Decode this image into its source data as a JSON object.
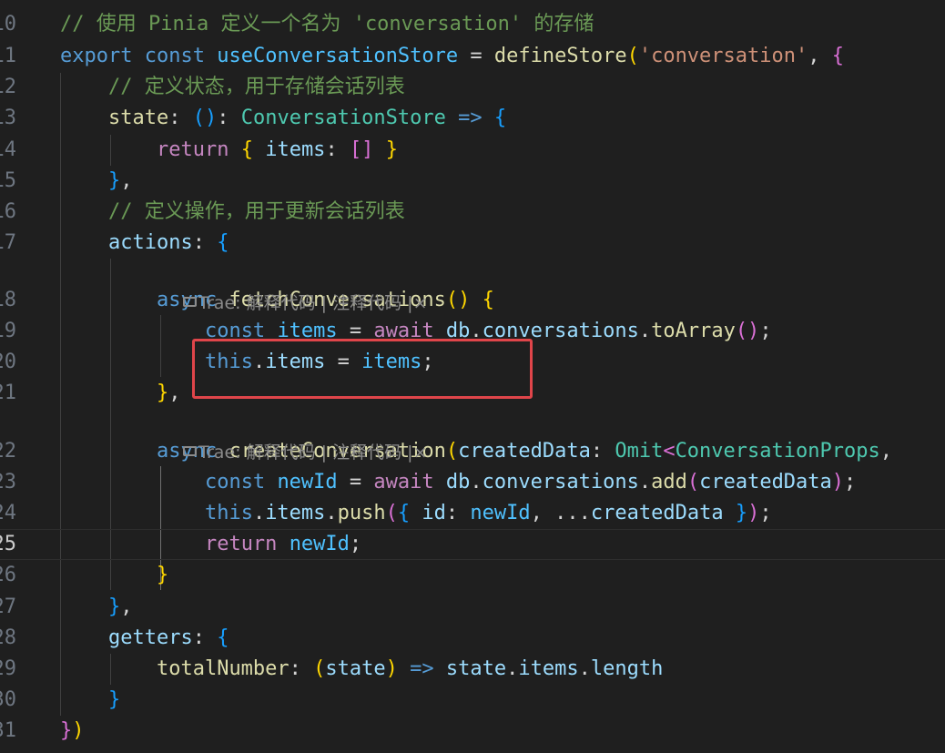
{
  "editor": {
    "lines": [
      {
        "n": "10",
        "tokens": [
          {
            "c": "c",
            "t": "// 使用 Pinia 定义一个名为 'conversation' 的存储"
          }
        ]
      },
      {
        "n": "11",
        "tokens": [
          {
            "c": "k",
            "t": "export"
          },
          {
            "c": "p",
            "t": " "
          },
          {
            "c": "k",
            "t": "const"
          },
          {
            "c": "p",
            "t": " "
          },
          {
            "c": "cv",
            "t": "useConversationStore"
          },
          {
            "c": "p",
            "t": " = "
          },
          {
            "c": "f",
            "t": "defineStore"
          },
          {
            "c": "b1",
            "t": "("
          },
          {
            "c": "s",
            "t": "'conversation'"
          },
          {
            "c": "p",
            "t": ", "
          },
          {
            "c": "b2",
            "t": "{"
          }
        ]
      },
      {
        "n": "12",
        "tokens": [
          {
            "c": "p",
            "t": "    "
          },
          {
            "c": "c",
            "t": "// 定义状态，用于存储会话列表"
          }
        ]
      },
      {
        "n": "13",
        "tokens": [
          {
            "c": "p",
            "t": "    "
          },
          {
            "c": "f",
            "t": "state"
          },
          {
            "c": "p",
            "t": ": "
          },
          {
            "c": "b3",
            "t": "()"
          },
          {
            "c": "p",
            "t": ": "
          },
          {
            "c": "t",
            "t": "ConversationStore"
          },
          {
            "c": "p",
            "t": " "
          },
          {
            "c": "k",
            "t": "=>"
          },
          {
            "c": "p",
            "t": " "
          },
          {
            "c": "b3",
            "t": "{"
          }
        ]
      },
      {
        "n": "14",
        "tokens": [
          {
            "c": "p",
            "t": "        "
          },
          {
            "c": "kc",
            "t": "return"
          },
          {
            "c": "p",
            "t": " "
          },
          {
            "c": "b1",
            "t": "{"
          },
          {
            "c": "p",
            "t": " "
          },
          {
            "c": "v",
            "t": "items"
          },
          {
            "c": "p",
            "t": ": "
          },
          {
            "c": "b2",
            "t": "[]"
          },
          {
            "c": "p",
            "t": " "
          },
          {
            "c": "b1",
            "t": "}"
          }
        ]
      },
      {
        "n": "15",
        "tokens": [
          {
            "c": "p",
            "t": "    "
          },
          {
            "c": "b3",
            "t": "}"
          },
          {
            "c": "p",
            "t": ","
          }
        ]
      },
      {
        "n": "16",
        "tokens": [
          {
            "c": "p",
            "t": "    "
          },
          {
            "c": "c",
            "t": "// 定义操作，用于更新会话列表"
          }
        ]
      },
      {
        "n": "17",
        "tokens": [
          {
            "c": "p",
            "t": "    "
          },
          {
            "c": "v",
            "t": "actions"
          },
          {
            "c": "p",
            "t": ": "
          },
          {
            "c": "b3",
            "t": "{"
          }
        ]
      },
      {
        "n": "18",
        "tokens": [
          {
            "c": "p",
            "t": "        "
          },
          {
            "c": "k",
            "t": "async"
          },
          {
            "c": "p",
            "t": " "
          },
          {
            "c": "f",
            "t": "fetchConversations"
          },
          {
            "c": "b1",
            "t": "()"
          },
          {
            "c": "p",
            "t": " "
          },
          {
            "c": "b1",
            "t": "{"
          }
        ]
      },
      {
        "n": "19",
        "tokens": [
          {
            "c": "p",
            "t": "            "
          },
          {
            "c": "k",
            "t": "const"
          },
          {
            "c": "p",
            "t": " "
          },
          {
            "c": "cv",
            "t": "items"
          },
          {
            "c": "p",
            "t": " = "
          },
          {
            "c": "kc",
            "t": "await"
          },
          {
            "c": "p",
            "t": " "
          },
          {
            "c": "v",
            "t": "db"
          },
          {
            "c": "p",
            "t": "."
          },
          {
            "c": "v",
            "t": "conversations"
          },
          {
            "c": "p",
            "t": "."
          },
          {
            "c": "f",
            "t": "toArray"
          },
          {
            "c": "b2",
            "t": "()"
          },
          {
            "c": "p",
            "t": ";"
          }
        ]
      },
      {
        "n": "20",
        "tokens": [
          {
            "c": "p",
            "t": "            "
          },
          {
            "c": "k",
            "t": "this"
          },
          {
            "c": "p",
            "t": "."
          },
          {
            "c": "v",
            "t": "items"
          },
          {
            "c": "p",
            "t": " = "
          },
          {
            "c": "cv",
            "t": "items"
          },
          {
            "c": "p",
            "t": ";"
          }
        ]
      },
      {
        "n": "21",
        "tokens": [
          {
            "c": "p",
            "t": "        "
          },
          {
            "c": "b1",
            "t": "}"
          },
          {
            "c": "p",
            "t": ","
          }
        ]
      },
      {
        "n": "22",
        "tokens": [
          {
            "c": "p",
            "t": "        "
          },
          {
            "c": "k",
            "t": "async"
          },
          {
            "c": "p",
            "t": " "
          },
          {
            "c": "f",
            "t": "createConversation"
          },
          {
            "c": "b1",
            "t": "("
          },
          {
            "c": "v",
            "t": "createdData"
          },
          {
            "c": "p",
            "t": ": "
          },
          {
            "c": "t",
            "t": "Omit"
          },
          {
            "c": "b2",
            "t": "<"
          },
          {
            "c": "t",
            "t": "ConversationProps"
          },
          {
            "c": "p",
            "t": ","
          }
        ]
      },
      {
        "n": "23",
        "tokens": [
          {
            "c": "p",
            "t": "            "
          },
          {
            "c": "k",
            "t": "const"
          },
          {
            "c": "p",
            "t": " "
          },
          {
            "c": "cv",
            "t": "newId"
          },
          {
            "c": "p",
            "t": " = "
          },
          {
            "c": "kc",
            "t": "await"
          },
          {
            "c": "p",
            "t": " "
          },
          {
            "c": "v",
            "t": "db"
          },
          {
            "c": "p",
            "t": "."
          },
          {
            "c": "v",
            "t": "conversations"
          },
          {
            "c": "p",
            "t": "."
          },
          {
            "c": "f",
            "t": "add"
          },
          {
            "c": "b2",
            "t": "("
          },
          {
            "c": "v",
            "t": "createdData"
          },
          {
            "c": "b2",
            "t": ")"
          },
          {
            "c": "p",
            "t": ";"
          }
        ]
      },
      {
        "n": "24",
        "tokens": [
          {
            "c": "p",
            "t": "            "
          },
          {
            "c": "k",
            "t": "this"
          },
          {
            "c": "p",
            "t": "."
          },
          {
            "c": "v",
            "t": "items"
          },
          {
            "c": "p",
            "t": "."
          },
          {
            "c": "f",
            "t": "push"
          },
          {
            "c": "b2",
            "t": "("
          },
          {
            "c": "b3",
            "t": "{"
          },
          {
            "c": "p",
            "t": " "
          },
          {
            "c": "v",
            "t": "id"
          },
          {
            "c": "p",
            "t": ": "
          },
          {
            "c": "cv",
            "t": "newId"
          },
          {
            "c": "p",
            "t": ", ..."
          },
          {
            "c": "v",
            "t": "createdData"
          },
          {
            "c": "p",
            "t": " "
          },
          {
            "c": "b3",
            "t": "}"
          },
          {
            "c": "b2",
            "t": ")"
          },
          {
            "c": "p",
            "t": ";"
          }
        ]
      },
      {
        "n": "25",
        "current": true,
        "tokens": [
          {
            "c": "p",
            "t": "            "
          },
          {
            "c": "kc",
            "t": "return"
          },
          {
            "c": "p",
            "t": " "
          },
          {
            "c": "cv",
            "t": "newId"
          },
          {
            "c": "p",
            "t": ";"
          }
        ]
      },
      {
        "n": "26",
        "tokens": [
          {
            "c": "p",
            "t": "        "
          },
          {
            "c": "b1",
            "t": "}"
          }
        ]
      },
      {
        "n": "27",
        "tokens": [
          {
            "c": "p",
            "t": "    "
          },
          {
            "c": "b3",
            "t": "}"
          },
          {
            "c": "p",
            "t": ","
          }
        ]
      },
      {
        "n": "28",
        "tokens": [
          {
            "c": "p",
            "t": "    "
          },
          {
            "c": "v",
            "t": "getters"
          },
          {
            "c": "p",
            "t": ": "
          },
          {
            "c": "b3",
            "t": "{"
          }
        ]
      },
      {
        "n": "29",
        "tokens": [
          {
            "c": "p",
            "t": "        "
          },
          {
            "c": "f",
            "t": "totalNumber"
          },
          {
            "c": "p",
            "t": ": "
          },
          {
            "c": "b1",
            "t": "("
          },
          {
            "c": "v",
            "t": "state"
          },
          {
            "c": "b1",
            "t": ")"
          },
          {
            "c": "p",
            "t": " "
          },
          {
            "c": "k",
            "t": "=>"
          },
          {
            "c": "p",
            "t": " "
          },
          {
            "c": "v",
            "t": "state"
          },
          {
            "c": "p",
            "t": "."
          },
          {
            "c": "v",
            "t": "items"
          },
          {
            "c": "p",
            "t": "."
          },
          {
            "c": "v",
            "t": "length"
          }
        ]
      },
      {
        "n": "30",
        "tokens": [
          {
            "c": "p",
            "t": "    "
          },
          {
            "c": "b3",
            "t": "}"
          }
        ]
      },
      {
        "n": "31",
        "tokens": [
          {
            "c": "b2",
            "t": "}"
          },
          {
            "c": "b1",
            "t": ")"
          }
        ]
      }
    ],
    "codelens": {
      "brand": "Trae:",
      "explain": "解释代码",
      "separator": "|",
      "comment": "注释代码",
      "close": "×"
    }
  },
  "colors": {
    "background": "#1f1f1f",
    "annotation_box": "#e0454a"
  }
}
